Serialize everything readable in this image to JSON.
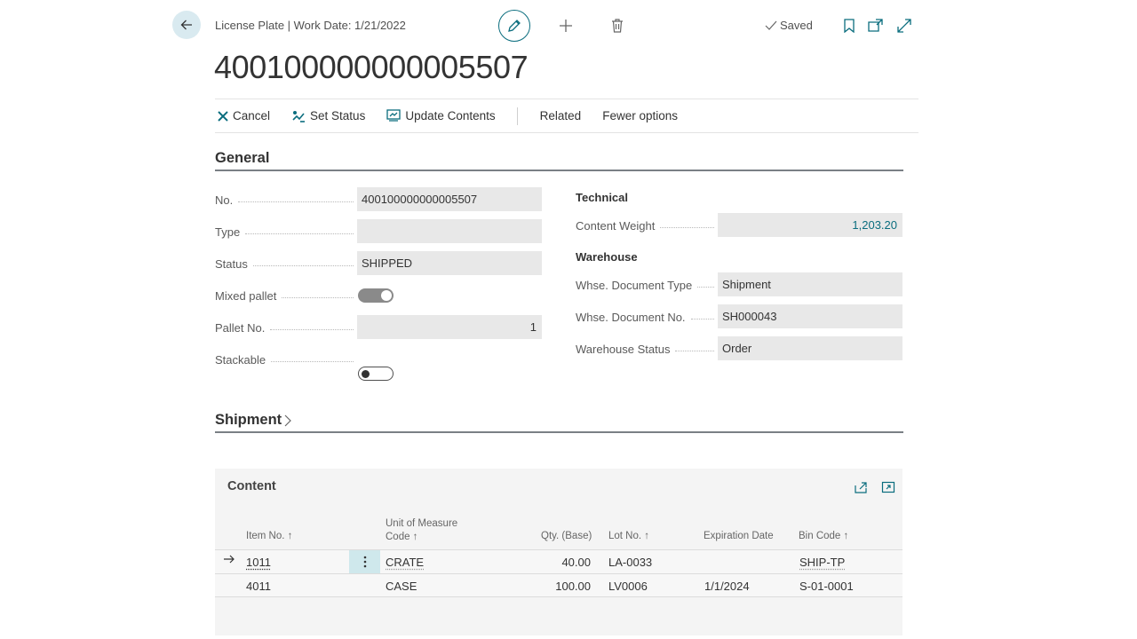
{
  "header": {
    "caption": "License Plate | Work Date: 1/21/2022",
    "saved_label": "Saved",
    "title": "400100000000005507"
  },
  "actions": {
    "cancel": "Cancel",
    "set_status": "Set Status",
    "update_contents": "Update Contents",
    "related": "Related",
    "fewer_options": "Fewer options"
  },
  "general": {
    "title": "General",
    "no_label": "No.",
    "no_value": "400100000000005507",
    "type_label": "Type",
    "type_value": "",
    "status_label": "Status",
    "status_value": "SHIPPED",
    "mixed_pallet_label": "Mixed pallet",
    "mixed_pallet_value": true,
    "pallet_no_label": "Pallet No.",
    "pallet_no_value": "1",
    "stackable_label": "Stackable",
    "stackable_value": false,
    "technical_heading": "Technical",
    "content_weight_label": "Content Weight",
    "content_weight_value": "1,203.20",
    "warehouse_heading": "Warehouse",
    "whse_doc_type_label": "Whse. Document Type",
    "whse_doc_type_value": "Shipment",
    "whse_doc_no_label": "Whse. Document No.",
    "whse_doc_no_value": "SH000043",
    "whse_status_label": "Warehouse Status",
    "whse_status_value": "Order"
  },
  "shipment": {
    "title": "Shipment"
  },
  "content": {
    "title": "Content",
    "columns": {
      "item_no": "Item No. ↑",
      "uom_line1": "Unit of Measure",
      "uom_line2": "Code ↑",
      "qty_base": "Qty. (Base)",
      "lot_no": "Lot No. ↑",
      "expiration": "Expiration Date",
      "bin_code": "Bin Code ↑"
    },
    "rows": [
      {
        "item_no": "1011",
        "uom": "CRATE",
        "qty": "40.00",
        "lot": "LA-0033",
        "exp": "",
        "bin": "SHIP-TP"
      },
      {
        "item_no": "4011",
        "uom": "CASE",
        "qty": "100.00",
        "lot": "LV0006",
        "exp": "1/1/2024",
        "bin": "S-01-0001"
      }
    ]
  },
  "colors": {
    "accent": "#0a6d7e",
    "field_bg": "#e8e8e8",
    "section_line": "#7a8085"
  }
}
